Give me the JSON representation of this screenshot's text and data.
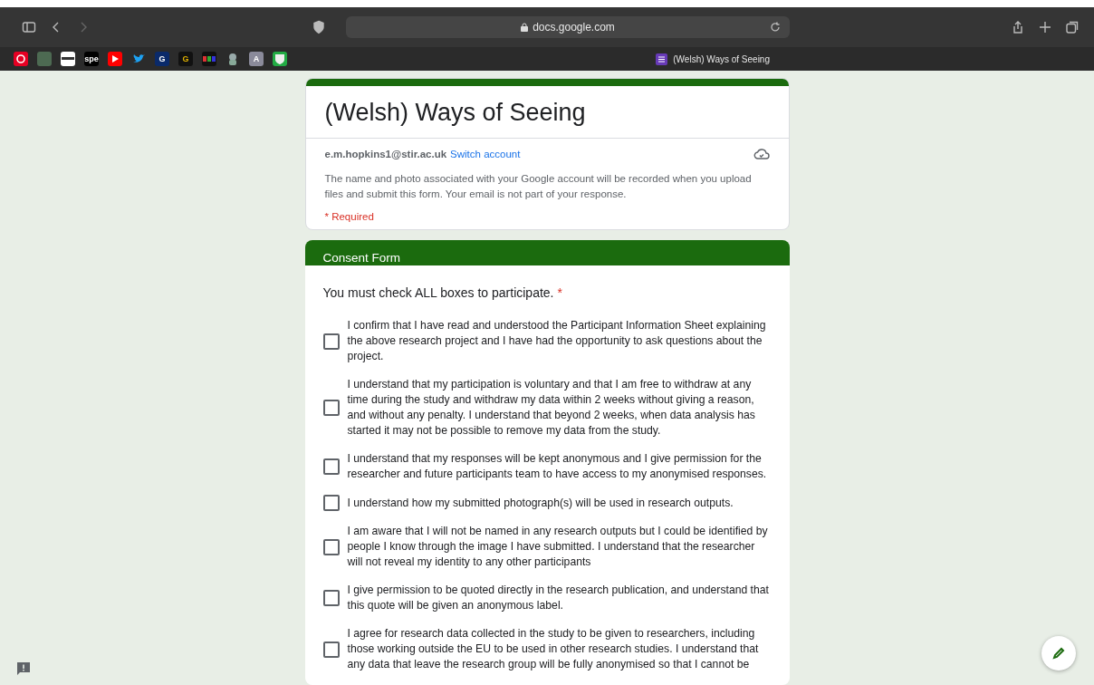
{
  "browser": {
    "address": "docs.google.com",
    "secure": true
  },
  "bookmarks": [
    {
      "kind": "pinterest"
    },
    {
      "kind": "green-square"
    },
    {
      "kind": "clapper"
    },
    {
      "kind": "text-tile",
      "label": "spe"
    },
    {
      "kind": "youtube"
    },
    {
      "kind": "bird"
    },
    {
      "kind": "letter-blue",
      "label": "G"
    },
    {
      "kind": "letter-gold",
      "label": "G"
    },
    {
      "kind": "stripes"
    },
    {
      "kind": "cat"
    },
    {
      "kind": "letter-grey",
      "label": "A"
    },
    {
      "kind": "crest"
    }
  ],
  "tab": {
    "title": "(Welsh) Ways of Seeing"
  },
  "form": {
    "title": "(Welsh) Ways of Seeing",
    "account": "e.m.hopkins1@stir.ac.uk",
    "switch_account": "Switch account",
    "notice": "The name and photo associated with your Google account will be recorded when you upload files and submit this form. Your email is not part of your response.",
    "required_note": "* Required"
  },
  "section": {
    "title": "Consent Form",
    "question": "You must check ALL boxes to participate.",
    "required_mark": "*",
    "options": [
      {
        "label": "I confirm that I have read and understood the Participant Information Sheet explaining the above research project and I have had the opportunity to ask questions about the project.",
        "checked": false
      },
      {
        "label": "I understand that my participation is voluntary and that I am free to withdraw at any time during the study and withdraw my data within 2 weeks without giving a reason, and without any penalty. I understand that beyond 2 weeks, when data analysis has started it may not be possible to remove my data from the study.",
        "checked": false
      },
      {
        "label": "I understand that my responses will be kept anonymous and I give permission for the researcher and future participants team to have access to my anonymised responses.",
        "checked": false
      },
      {
        "label": "I understand how my submitted photograph(s) will be used in research outputs.",
        "checked": false
      },
      {
        "label": "I am aware that I will not be named in any research outputs but I could be identified by people I know through the image I have submitted. I understand that the researcher will not reveal my identity to any other participants",
        "checked": false
      },
      {
        "label": "I give permission to be quoted directly in the research publication, and understand that this quote will be given an anonymous label.",
        "checked": false
      },
      {
        "label": "I agree for research data collected in the study to be given to researchers, including those working outside the EU to be used in other research studies. I understand that any data that leave the research group will be fully anonymised so that I cannot be",
        "checked": false
      }
    ]
  }
}
